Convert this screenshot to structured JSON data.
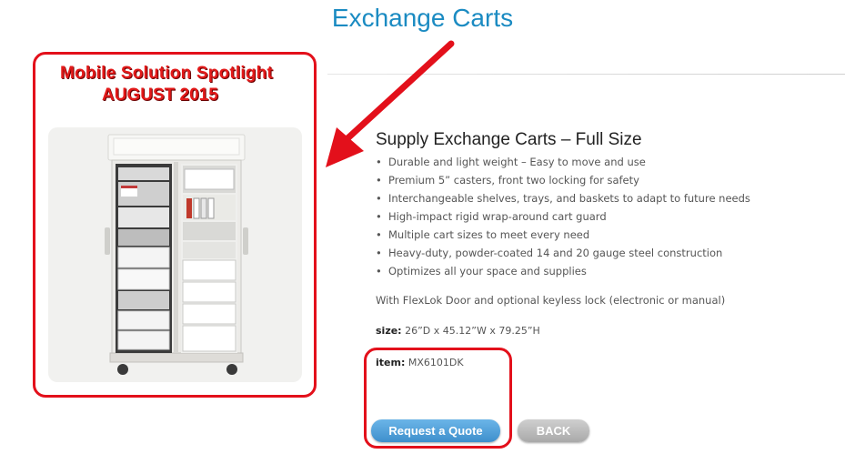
{
  "page": {
    "title": "Exchange Carts"
  },
  "spotlight": {
    "line1": "Mobile Solution Spotlight",
    "line2": "AUGUST 2015"
  },
  "product": {
    "title": "Supply Exchange Carts – Full Size",
    "features": [
      "Durable and light weight – Easy to move and use",
      "Premium 5” casters, front two locking for safety",
      "Interchangeable shelves, trays, and baskets to adapt to future needs",
      "High-impact rigid wrap-around cart guard",
      "Multiple cart sizes to meet every need",
      "Heavy-duty, powder-coated 14 and 20 gauge steel construction",
      "Optimizes all your space and supplies"
    ],
    "bullet": "•",
    "note": "With FlexLok Door and optional keyless lock (electronic or manual)",
    "size_label": "size:",
    "size_value": "26”D x 45.12”W x 79.25”H",
    "item_label": "item:",
    "item_value": "MX6101DK"
  },
  "buttons": {
    "quote": "Request a Quote",
    "back": "BACK"
  },
  "colors": {
    "title_blue": "#1b8bc2",
    "highlight_red": "#e3101b",
    "quote_blue": "#4a9bd6",
    "back_gray": "#b5b5b5"
  }
}
